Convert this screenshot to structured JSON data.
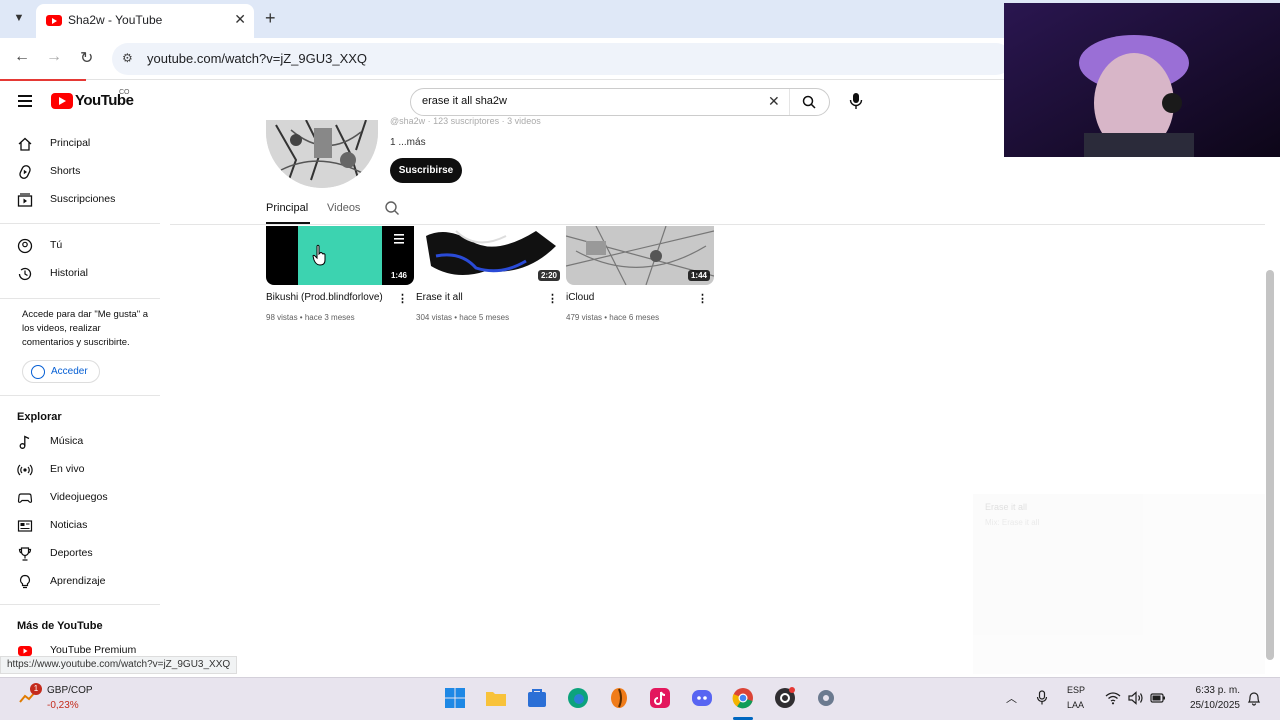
{
  "browser": {
    "tab_title": "Sha2w - YouTube",
    "tab_close": "✕",
    "new_tab": "+",
    "url": "youtube.com/watch?v=jZ_9GU3_XXQ"
  },
  "masthead": {
    "logo_text": "YouTube",
    "country": "CO",
    "search_value": "erase it all sha2w",
    "search_clear": "✕"
  },
  "sidebar": {
    "items": [
      {
        "label": "Principal",
        "icon": "home-icon"
      },
      {
        "label": "Shorts",
        "icon": "shorts-icon"
      },
      {
        "label": "Suscripciones",
        "icon": "subscriptions-icon"
      },
      {
        "label": "Tú",
        "icon": "you-icon"
      },
      {
        "label": "Historial",
        "icon": "history-icon"
      }
    ],
    "signin_note": "Accede para dar \"Me gusta\" a los videos, realizar comentarios y suscribirte.",
    "signin_button": "Acceder",
    "explore_heading": "Explorar",
    "explore": [
      {
        "label": "Música",
        "icon": "music-icon"
      },
      {
        "label": "En vivo",
        "icon": "live-icon"
      },
      {
        "label": "Videojuegos",
        "icon": "gaming-icon"
      },
      {
        "label": "Noticias",
        "icon": "news-icon"
      },
      {
        "label": "Deportes",
        "icon": "sports-icon"
      },
      {
        "label": "Aprendizaje",
        "icon": "learning-icon"
      }
    ],
    "more_heading": "Más de YouTube",
    "more": [
      {
        "label": "YouTube Premium",
        "icon": "youtube-premium-icon"
      }
    ]
  },
  "channel": {
    "meta": "@sha2w · 123 suscriptores · 3 videos",
    "description": "1 ...más",
    "subscribe": "Suscribirse",
    "tabs": [
      "Principal",
      "Videos"
    ],
    "active_tab": "Principal"
  },
  "videos": [
    {
      "title": "Bikushi (Prod.blindforlove)",
      "meta": "98 vistas • hace 3 meses",
      "duration": "1:46"
    },
    {
      "title": "Erase it all",
      "meta": "304 vistas • hace 5 meses",
      "duration": "2:20"
    },
    {
      "title": "iCloud",
      "meta": "479 vistas • hace 6 meses",
      "duration": "1:44"
    }
  ],
  "miniplayer": {
    "title": "Erase it all",
    "subtitle": "Mix: Erase it all"
  },
  "status_url": "https://www.youtube.com/watch?v=jZ_9GU3_XXQ",
  "taskbar": {
    "ticker": "GBP/COP",
    "change": "-0,23%",
    "badge": "1",
    "lang_top": "ESP",
    "lang_bottom": "LAA",
    "time": "6:33 p. m.",
    "date": "25/10/2025"
  },
  "colors": {
    "youtube_red": "#ff0000",
    "link_blue": "#065fd4",
    "thumb_teal": "#3cd3b0"
  }
}
